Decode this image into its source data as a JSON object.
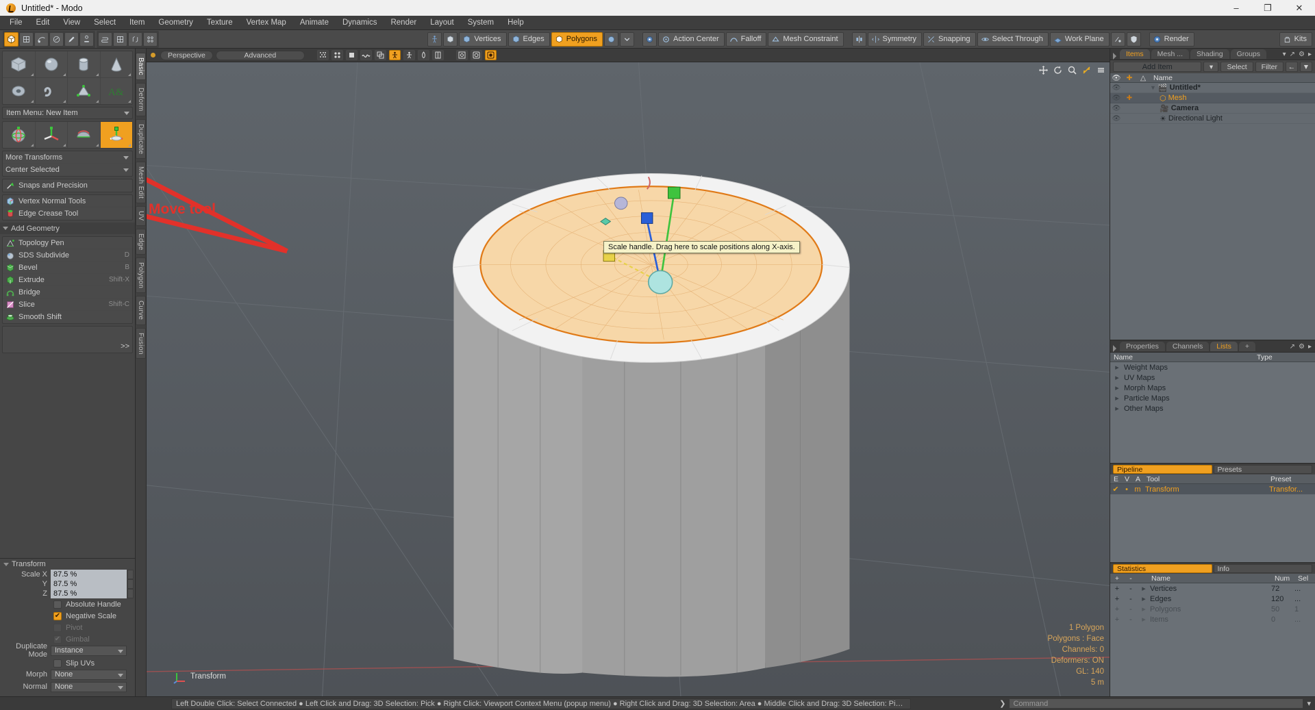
{
  "window": {
    "title": "Untitled* - Modo",
    "minimize": "–",
    "maximize": "❐",
    "close": "✕"
  },
  "menubar": {
    "items": [
      "File",
      "Edit",
      "View",
      "Select",
      "Item",
      "Geometry",
      "Texture",
      "Vertex Map",
      "Animate",
      "Dynamics",
      "Render",
      "Layout",
      "System",
      "Help"
    ]
  },
  "toolbar": {
    "left_icons": [
      "cube-icon",
      "grid-icon",
      "lasso-icon",
      "paint-icon",
      "brush-icon",
      "stamp-icon",
      "flow-icon",
      "lattice-icon",
      "snap-icon",
      "uv-icon"
    ],
    "mode_items": [
      "Vertices",
      "Edges",
      "Polygons"
    ],
    "mode_selected": "Polygons",
    "center": "Action Center",
    "falloff": "Falloff",
    "mesh_constraint": "Mesh Constraint",
    "symmetry": "Symmetry",
    "snapping": "Snapping",
    "select_through": "Select Through",
    "work_plane": "Work Plane",
    "render": "Render",
    "kits": "Kits"
  },
  "left_panel": {
    "primitives_row1": [
      "cube-primitive",
      "sphere-primitive",
      "cylinder-primitive",
      "cone-primitive"
    ],
    "primitives_row2": [
      "torus-primitive",
      "spline-primitive",
      "triangle-primitive",
      "text-primitive"
    ],
    "item_menu": "Item Menu: New Item",
    "transforms_row": [
      "rotate-tool",
      "move-tool",
      "stretch-tool",
      "scale-tool"
    ],
    "transform_selected_index": 3,
    "more_transforms": "More Transforms",
    "center_selected": "Center Selected",
    "snaps_and_precision": "Snaps and Precision",
    "tools": [
      {
        "label": "Vertex Normal Tools",
        "shortcut": "",
        "icon": "vertex-normal-icon"
      },
      {
        "label": "Edge Crease Tool",
        "shortcut": "",
        "icon": "edge-crease-icon"
      }
    ],
    "add_geometry_header": "Add Geometry",
    "geometry_tools": [
      {
        "label": "Topology Pen",
        "shortcut": "",
        "icon": "topology-pen-icon"
      },
      {
        "label": "SDS Subdivide",
        "shortcut": "D",
        "icon": "sds-subdivide-icon"
      },
      {
        "label": "Bevel",
        "shortcut": "B",
        "icon": "bevel-icon"
      },
      {
        "label": "Extrude",
        "shortcut": "Shift-X",
        "icon": "extrude-icon"
      },
      {
        "label": "Bridge",
        "shortcut": "",
        "icon": "bridge-icon"
      },
      {
        "label": "Slice",
        "shortcut": "Shift-C",
        "icon": "slice-icon"
      },
      {
        "label": "Smooth Shift",
        "shortcut": "",
        "icon": "smooth-shift-icon"
      }
    ],
    "more_chevron": ">>",
    "vertical_tabs": [
      {
        "label": "Basic",
        "active": true
      },
      {
        "label": "Deform",
        "active": false
      },
      {
        "label": "Duplicate",
        "active": false
      },
      {
        "label": "Mesh Edit",
        "active": false
      },
      {
        "label": "UV",
        "active": false
      },
      {
        "label": "Edge",
        "active": false
      },
      {
        "label": "Polygon",
        "active": false
      },
      {
        "label": "Curve",
        "active": false
      },
      {
        "label": "Fusion",
        "active": false
      }
    ]
  },
  "transform_props": {
    "header": "Transform",
    "scale_x_label": "Scale X",
    "scale_y_label": "Y",
    "scale_z_label": "Z",
    "scale_x": "87.5 %",
    "scale_y": "87.5 %",
    "scale_z": "87.5 %",
    "absolute_handle": {
      "label": "Absolute Handle",
      "checked": false,
      "disabled": false
    },
    "negative_scale": {
      "label": "Negative Scale",
      "checked": true,
      "disabled": false
    },
    "pivot": {
      "label": "Pivot",
      "checked": false,
      "disabled": true
    },
    "gimbal": {
      "label": "Gimbal",
      "checked": true,
      "disabled": true
    },
    "duplicate_mode_label": "Duplicate Mode",
    "duplicate_mode_value": "Instance",
    "slip_uvs": {
      "label": "Slip UVs",
      "checked": false,
      "disabled": false
    },
    "morph_label": "Morph",
    "morph_value": "None",
    "normal_label": "Normal",
    "normal_value": "None"
  },
  "viewport": {
    "dot": "view-indicator",
    "view_mode": "Perspective",
    "shading_mode": "Advanced",
    "toggle_icons": [
      "halftone-icon",
      "dots-icon",
      "square-icon",
      "wave-icon",
      "copy-icon",
      "person-icon",
      "stats-icon",
      "drop-icon",
      "book-icon"
    ],
    "active_toggle_index": 5,
    "right_icons": [
      "camera-dot-icon",
      "camera-ring-icon",
      "record-icon"
    ],
    "active_right_index": 2,
    "nav_icons": [
      "pan-icon",
      "rotate-icon",
      "zoom-icon",
      "fit-icon",
      "more-icon"
    ],
    "tooltip": "Scale handle. Drag here to scale positions along X-axis.",
    "annotation": "Move tool",
    "origin_label": "Transform",
    "stats": [
      "1 Polygon",
      "Polygons : Face",
      "Channels: 0",
      "Deformers: ON",
      "GL: 140",
      "5 m"
    ]
  },
  "items_panel": {
    "tabs": [
      {
        "label": "Items",
        "active": true
      },
      {
        "label": "Mesh ...",
        "active": false
      },
      {
        "label": "Shading",
        "active": false
      },
      {
        "label": "Groups",
        "active": false
      }
    ],
    "tab_icons": [
      "chevron-down-icon",
      "expand-icon",
      "gear-icon",
      "chevron-right-icon"
    ],
    "add_item": "Add Item",
    "select": "Select",
    "filter": "Filter",
    "columns": [
      "eye-icon",
      "transform-icon",
      "axis-icon",
      "Name"
    ],
    "rows": [
      {
        "name": "Untitled*",
        "indent": 0,
        "eye": true,
        "bold": true,
        "selected": false,
        "icon": "scene-icon",
        "expander": true
      },
      {
        "name": "Mesh",
        "indent": 1,
        "eye": true,
        "bold": false,
        "selected": true,
        "icon": "mesh-icon",
        "expander": false
      },
      {
        "name": "Camera",
        "indent": 1,
        "eye": true,
        "bold": true,
        "selected": false,
        "icon": "camera-icon",
        "expander": false
      },
      {
        "name": "Directional Light",
        "indent": 1,
        "eye": true,
        "bold": false,
        "selected": false,
        "icon": "light-icon",
        "expander": false
      }
    ]
  },
  "lists_panel": {
    "tabs": [
      {
        "label": "Properties",
        "active": false
      },
      {
        "label": "Channels",
        "active": false
      },
      {
        "label": "Lists",
        "active": true
      },
      {
        "label": "+",
        "active": false
      }
    ],
    "columns": [
      "Name",
      "Type"
    ],
    "rows": [
      "Weight Maps",
      "UV Maps",
      "Morph Maps",
      "Particle Maps",
      "Other Maps"
    ]
  },
  "pipeline_panel": {
    "tabs": [
      {
        "label": "Pipeline",
        "active": true
      },
      {
        "label": "Presets",
        "active": false
      }
    ],
    "columns": [
      "E",
      "V",
      "A",
      "Tool",
      "Preset"
    ],
    "rows": [
      {
        "e": "✔",
        "v": "•",
        "a": "m",
        "tool": "Transform",
        "preset": "Transfor..."
      }
    ]
  },
  "statistics_panel": {
    "tabs": [
      {
        "label": "Statistics",
        "active": true
      },
      {
        "label": "Info",
        "active": false
      }
    ],
    "columns": [
      "+",
      "-",
      "Name",
      "Num",
      "Sel"
    ],
    "rows": [
      {
        "plus": "+",
        "minus": "-",
        "name": "Vertices",
        "num": "72",
        "sel": "...",
        "dim": false
      },
      {
        "plus": "+",
        "minus": "-",
        "name": "Edges",
        "num": "120",
        "sel": "...",
        "dim": false
      },
      {
        "plus": "+",
        "minus": "-",
        "name": "Polygons",
        "num": "50",
        "sel": "1",
        "dim": true
      },
      {
        "plus": "+",
        "minus": "-",
        "name": "Items",
        "num": "0",
        "sel": "...",
        "dim": true
      }
    ]
  },
  "statusbar": {
    "hint": "Left Double Click: Select Connected ● Left Click and Drag: 3D Selection: Pick ● Right Click: Viewport Context Menu (popup menu) ● Right Click and Drag: 3D Selection: Area ● Middle Click and Drag: 3D Selection: Pick Through ● [Any Key]-[Any Button] Click and Drag: dragDropB ...",
    "command_label": "Command",
    "command_value": ""
  },
  "colors": {
    "accent": "#f0a020",
    "panel": "#464646",
    "grid": "#6a7076",
    "annotation": "#e2312a"
  }
}
